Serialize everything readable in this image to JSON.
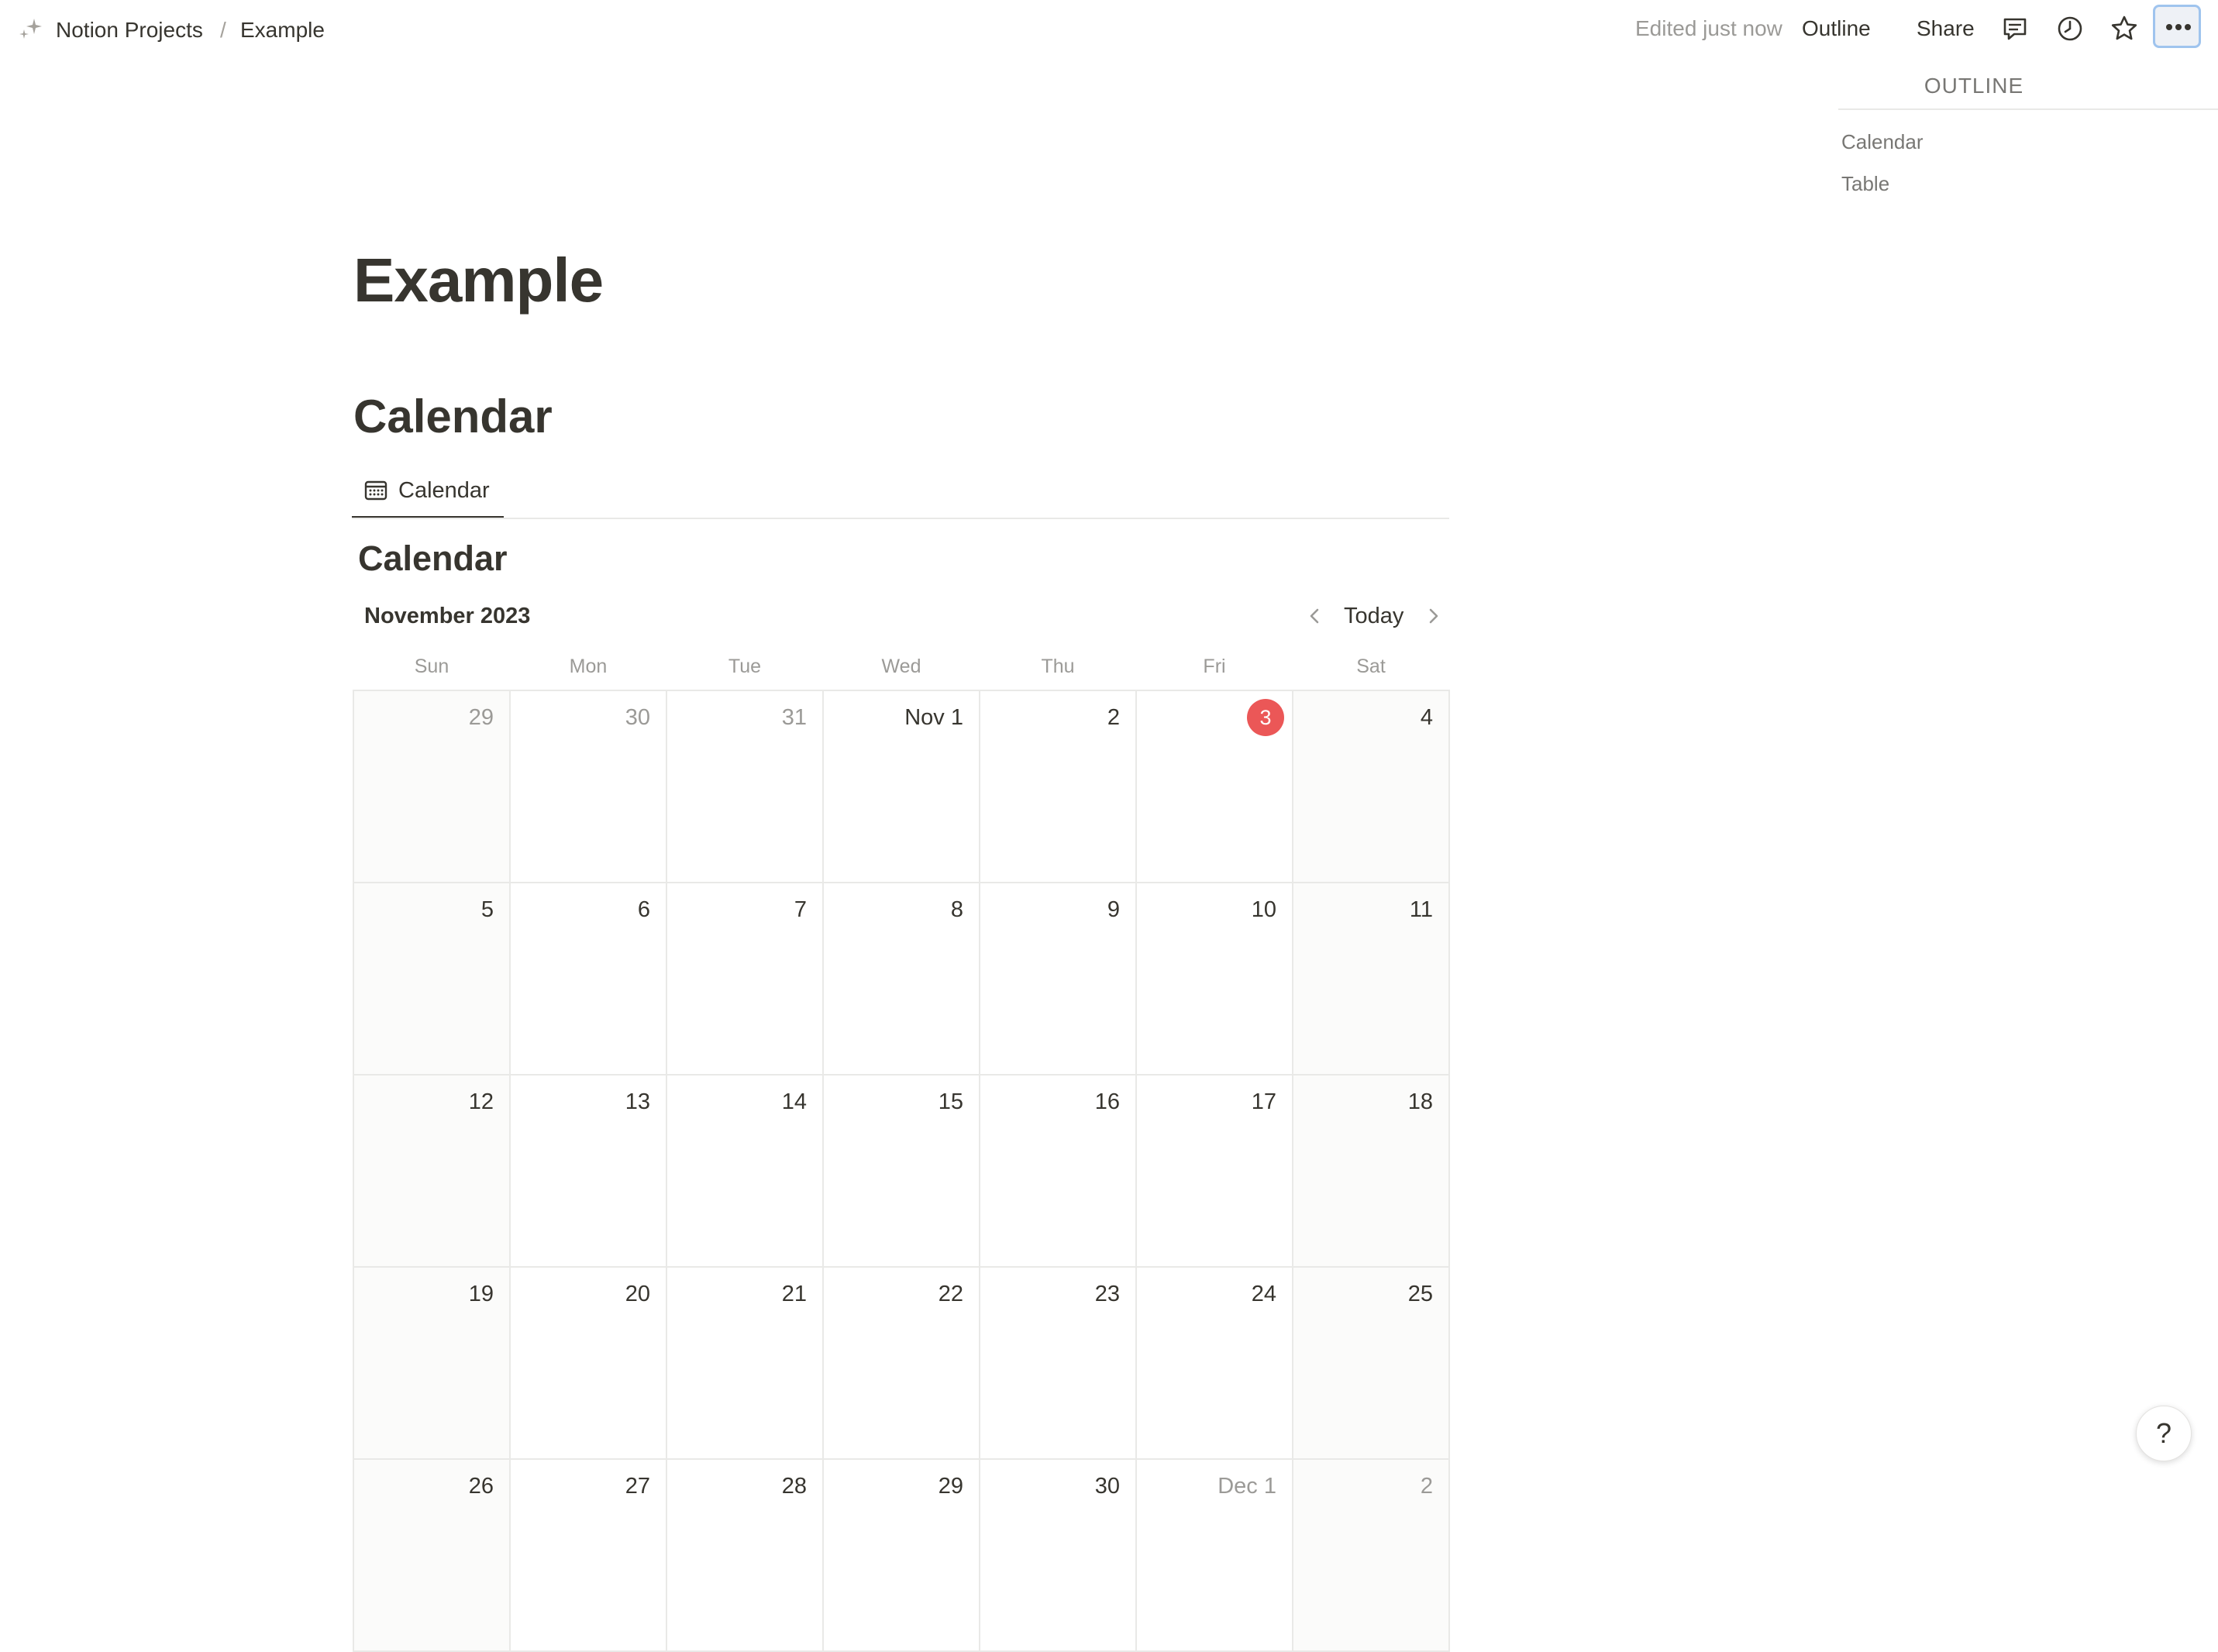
{
  "breadcrumb": {
    "root": "Notion Projects",
    "separator": "/",
    "page": "Example"
  },
  "topbar": {
    "edited": "Edited just now",
    "outline": "Outline",
    "share": "Share",
    "icons": [
      "comments-icon",
      "history-icon",
      "star-icon",
      "more-icon"
    ]
  },
  "outline_panel": {
    "title": "OUTLINE",
    "items": [
      "Calendar",
      "Table"
    ]
  },
  "page": {
    "title": "Example",
    "heading": "Calendar"
  },
  "view_tab": {
    "label": "Calendar",
    "icon": "calendar-icon"
  },
  "calendar": {
    "title": "Calendar",
    "month": "November 2023",
    "today_label": "Today",
    "weekdays": [
      "Sun",
      "Mon",
      "Tue",
      "Wed",
      "Thu",
      "Fri",
      "Sat"
    ],
    "today_color": "#eb5757",
    "weeks": [
      [
        {
          "label": "29",
          "out": true
        },
        {
          "label": "30",
          "out": true
        },
        {
          "label": "31",
          "out": true
        },
        {
          "label": "Nov 1"
        },
        {
          "label": "2"
        },
        {
          "label": "3",
          "today": true
        },
        {
          "label": "4"
        }
      ],
      [
        {
          "label": "5"
        },
        {
          "label": "6"
        },
        {
          "label": "7"
        },
        {
          "label": "8"
        },
        {
          "label": "9"
        },
        {
          "label": "10"
        },
        {
          "label": "11"
        }
      ],
      [
        {
          "label": "12"
        },
        {
          "label": "13"
        },
        {
          "label": "14"
        },
        {
          "label": "15"
        },
        {
          "label": "16"
        },
        {
          "label": "17"
        },
        {
          "label": "18"
        }
      ],
      [
        {
          "label": "19"
        },
        {
          "label": "20"
        },
        {
          "label": "21"
        },
        {
          "label": "22"
        },
        {
          "label": "23"
        },
        {
          "label": "24"
        },
        {
          "label": "25"
        }
      ],
      [
        {
          "label": "26"
        },
        {
          "label": "27"
        },
        {
          "label": "28"
        },
        {
          "label": "29"
        },
        {
          "label": "30"
        },
        {
          "label": "Dec 1",
          "out": true
        },
        {
          "label": "2",
          "out": true
        }
      ]
    ]
  },
  "help": {
    "label": "?"
  }
}
